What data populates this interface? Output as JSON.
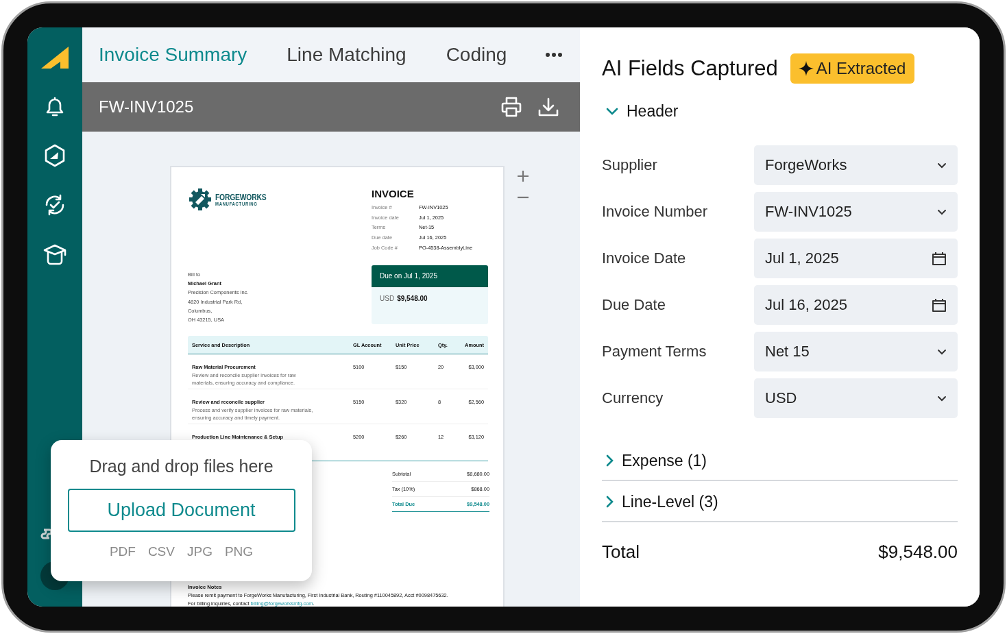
{
  "tabs": [
    {
      "label": "Invoice Summary",
      "selected": true
    },
    {
      "label": "Line Matching",
      "selected": false
    },
    {
      "label": "Coding",
      "selected": false
    }
  ],
  "document_bar": {
    "title": "FW-INV1025"
  },
  "invoice": {
    "company": {
      "name": "FORGEWORKS",
      "subtitle": "MANUFACTURING"
    },
    "title": "INVOICE",
    "meta": [
      {
        "label": "Invoice #",
        "value": "FW-INV1025"
      },
      {
        "label": "Invoice date",
        "value": "Jul 1, 2025"
      },
      {
        "label": "Terms",
        "value": "Net-15"
      },
      {
        "label": "Due date",
        "value": "Jul 16, 2025"
      },
      {
        "label": "Job Code #",
        "value": "PO-4538-AssemblyLine"
      }
    ],
    "bill_to": {
      "label": "Bill to",
      "name": "Michael Grant",
      "lines": [
        "Precision Components Inc.",
        "4820 Industrial Park Rd,",
        "Columbus,",
        "OH 43215, USA"
      ]
    },
    "due_box": {
      "heading": "Due on Jul 1, 2025",
      "currency": "USD",
      "amount": "$9,548.00"
    },
    "table": {
      "columns": [
        "Service and Description",
        "GL Account",
        "Unit Price",
        "Qty.",
        "Amount"
      ],
      "rows": [
        {
          "service": "Raw Material Procurement",
          "description": "Review and reconcile supplier invoices for raw materials, ensuring accuracy and compliance.",
          "gl_account": "5100",
          "unit_price": "$150",
          "qty": "20",
          "amount": "$3,000"
        },
        {
          "service": "Review and reconcile supplier",
          "description": "Process and verify supplier invoices for raw materials, ensuring accuracy and timely payment.",
          "gl_account": "5150",
          "unit_price": "$320",
          "qty": "8",
          "amount": "$2,560"
        },
        {
          "service": "Production Line Maintenance & Setup",
          "gl_account": "5200",
          "unit_price": "$260",
          "qty": "12",
          "amount": "$3,120"
        }
      ]
    },
    "totals": [
      {
        "label": "Subtotal",
        "value": "$8,680.00",
        "kind": "line"
      },
      {
        "label": "Tax (10%)",
        "value": "$868.00",
        "kind": "line"
      },
      {
        "label": "Total Due",
        "value": "$9,548.00",
        "kind": "total"
      }
    ],
    "notes": {
      "heading": "Invoice Notes",
      "payment": "Please remit payment to ForgeWorks Manufacturing, First Industrial Bank, Routing #110045892, Acct #0098475632.",
      "contact_text": "For billing inquiries, contact ",
      "contact_email": "billing@forgeworksmfg.com",
      "contact_end": "."
    }
  },
  "upload": {
    "hint": "Drag and drop files here",
    "button": "Upload Document",
    "formats": [
      "PDF",
      "CSV",
      "JPG",
      "PNG"
    ]
  },
  "fields_panel": {
    "title": "AI Fields Captured",
    "badge": "AI Extracted",
    "sections": [
      {
        "label": "Header",
        "expanded": true,
        "fields": [
          {
            "label": "Supplier",
            "value": "ForgeWorks",
            "kind": "select"
          },
          {
            "label": "Invoice Number",
            "value": "FW-INV1025",
            "kind": "select"
          },
          {
            "label": "Invoice Date",
            "value": "Jul 1, 2025",
            "kind": "date"
          },
          {
            "label": "Due Date",
            "value": "Jul 16, 2025",
            "kind": "date"
          },
          {
            "label": "Payment Terms",
            "value": "Net 15",
            "kind": "select"
          },
          {
            "label": "Currency",
            "value": "USD",
            "kind": "select"
          }
        ]
      },
      {
        "label": "Expense (1)",
        "expanded": false
      },
      {
        "label": "Line-Level (3)",
        "expanded": false
      }
    ],
    "total": {
      "label": "Total",
      "value": "$9,548.00"
    }
  }
}
